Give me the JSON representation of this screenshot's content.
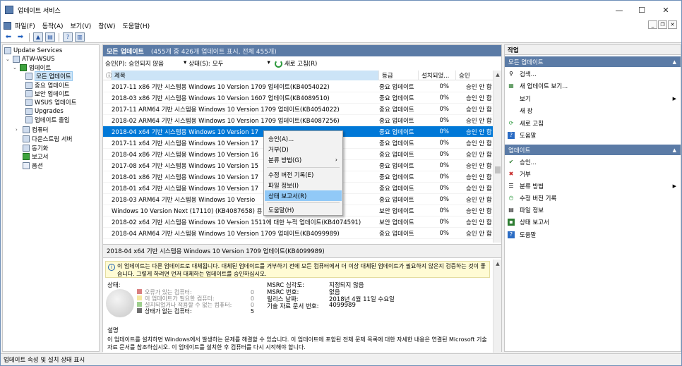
{
  "window": {
    "title": "업데이트 서비스"
  },
  "menu": [
    "파일(F)",
    "동작(A)",
    "보기(V)",
    "창(W)",
    "도움말(H)"
  ],
  "tree": {
    "root": "Update Services",
    "server": "ATW-WSUS",
    "updates": "업데이트",
    "children": [
      "모든 업데이트",
      "중요 업데이트",
      "보안 업데이트",
      "WSUS 업데이트",
      "Upgrades",
      "업데이트 출입"
    ],
    "computers": "컴퓨터",
    "downstream": "다운스트림 서버",
    "sync": "동기화",
    "reports": "보고서",
    "options": "옵션"
  },
  "center": {
    "header_title": "모든 업데이트",
    "header_sub": "(455개 중 426개 업데이트 표시, 전체 455개)",
    "filter_approval_label": "승인(P):",
    "filter_approval_value": "승인되지 않음",
    "filter_status_label": "상태(S):",
    "filter_status_value": "모두",
    "refresh_label": "새로 고침(R)",
    "columns": [
      "제목",
      "등급",
      "설치되었...",
      "승인"
    ],
    "rows": [
      {
        "title": "2017-11 x86 기반 시스템용 Windows 10 Version 1709 업데이트(KB4054022)",
        "class": "중요 업데이트",
        "installed": "0%",
        "approval": "승인 안 함"
      },
      {
        "title": "2018-03 x86 기반 시스템용 Windows 10 Version 1607 업데이트(KB4089510)",
        "class": "중요 업데이트",
        "installed": "0%",
        "approval": "승인 안 함"
      },
      {
        "title": "2017-11 ARM64 기반 시스템용 Windows 10 Version 1709 업데이트(KB4054022)",
        "class": "중요 업데이트",
        "installed": "0%",
        "approval": "승인 안 함"
      },
      {
        "title": "2018-02 ARM64 기반 시스템용 Windows 10 Version 1709 업데이트(KB4087256)",
        "class": "중요 업데이트",
        "installed": "0%",
        "approval": "승인 안 함"
      },
      {
        "title": "2018-04 x64 기반 시스템용 Windows 10 Version 17",
        "class": "중요 업데이트",
        "installed": "0%",
        "approval": "승인 안 함"
      },
      {
        "title": "2017-11 x64 기반 시스템용 Windows 10 Version 17",
        "class": "중요 업데이트",
        "installed": "0%",
        "approval": "승인 안 함"
      },
      {
        "title": "2018-04 x86 기반 시스템용 Windows 10 Version 16",
        "class": "중요 업데이트",
        "installed": "0%",
        "approval": "승인 안 함"
      },
      {
        "title": "2017-08 x64 기반 시스템용 Windows 10 Version 15",
        "class": "중요 업데이트",
        "installed": "0%",
        "approval": "승인 안 함"
      },
      {
        "title": "2018-01 x86 기반 시스템용 Windows 10 Version 17",
        "class": "중요 업데이트",
        "installed": "0%",
        "approval": "승인 안 함"
      },
      {
        "title": "2018-01 x64 기반 시스템용 Windows 10 Version 17",
        "class": "중요 업데이트",
        "installed": "0%",
        "approval": "승인 안 함"
      },
      {
        "title": "2018-03 ARM64 기반 시스템용 Windows 10 Versio",
        "class": "중요 업데이트",
        "installed": "0%",
        "approval": "승인 안 함"
      },
      {
        "title": "Windows 10 Version Next (17110) (KB4087658) 용",
        "class": "보안 업데이트",
        "installed": "0%",
        "approval": "승인 안 함"
      },
      {
        "title": "2018-02 x64 기반 시스템용 Windows 10 Version 1511에 대한 누적 업데이트(KB4074591)",
        "class": "보안 업데이트",
        "installed": "0%",
        "approval": "승인 안 함"
      },
      {
        "title": "2018-04 ARM64 기반 시스템용 Windows 10 Version 1709 업데이트(KB4099989)",
        "class": "중요 업데이트",
        "installed": "0%",
        "approval": "승인 안 함"
      }
    ],
    "detail_title": "2018-04 x64 기반 시스템용 Windows 10 Version 1709 업데이트(KB4099989)",
    "info_text": "이 업데이트는 다른 업데이트로 대체됩니다. 대체된 업데이트를 거부하기 전에 모든 컴퓨터에서 더 이상 대체된 업데이트가 필요하지 않은지 검증하는 것이 좋습니다. 그렇게 하려면 먼저 대체하는 업데이트를 승인하십시오.",
    "status_label": "상태:",
    "legend": [
      {
        "label": "오류가 있는 컴퓨터:",
        "value": "0",
        "color": "#d98080",
        "muted": true
      },
      {
        "label": "이 업데이트가 필요한 컴퓨터:",
        "value": "0",
        "color": "#f5e8a0",
        "muted": true
      },
      {
        "label": "설치되었거나 적용할 수 없는 컴퓨터:",
        "value": "0",
        "color": "#9fd08f",
        "muted": true
      },
      {
        "label": "상태가 없는 컴퓨터:",
        "value": "5",
        "color": "#707070",
        "muted": false
      }
    ],
    "props": [
      {
        "k": "MSRC 심각도:",
        "v": "지정되지 않음"
      },
      {
        "k": "MSRC 번호:",
        "v": "없음"
      },
      {
        "k": "릴리스 날짜:",
        "v": "2018년 4월 11일 수요일"
      },
      {
        "k": "기술 자료 문서 번호:",
        "v": "4099989"
      }
    ],
    "desc_title": "설명",
    "desc_text": "이 업데이트를 설치하면 Windows에서 발생하는 문제를 해결할 수 있습니다. 이 업데이트에 포함된 전체 문제 목록에 대한 자세한 내용은 연결된 Microsoft 기술 자료 문서를 참조하십시오. 이 업데이트를 설치한 후 컴퓨터를 다시 시작해야 합니다."
  },
  "context_menu": [
    "승인(A)...",
    "거부(D)",
    "분류 방법(G)",
    "수정 버전 기록(E)",
    "파일 정보(I)",
    "상태 보고서(R)",
    "도움말(H)"
  ],
  "actions": {
    "header": "작업",
    "section1": "모든 업데이트",
    "items1": [
      "검색...",
      "새 업데이트 보기...",
      "보기",
      "새 창",
      "새로 고침",
      "도움말"
    ],
    "section2": "업데이트",
    "items2": [
      "승인...",
      "거부",
      "분류 방법",
      "수정 버전 기록",
      "파일 정보",
      "상태 보고서",
      "도움말"
    ]
  },
  "statusbar": "업데이트 속성 및 설치 상태 표시"
}
